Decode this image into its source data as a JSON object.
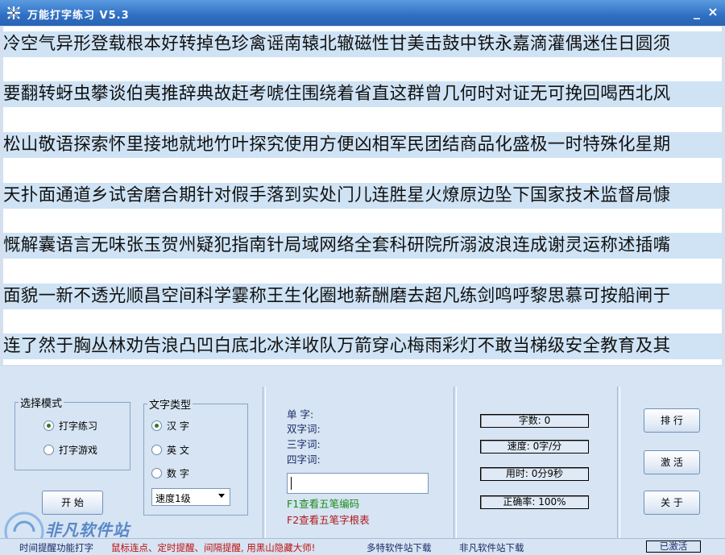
{
  "window": {
    "title": "万能打字练习 V5.3",
    "minimize": "_",
    "close": "×"
  },
  "text_lines": [
    "冷空气异形登载根本好转掉色珍禽谣南辕北辙磁性甘美击鼓中铁永嘉滴灌偶迷住日圆须",
    "要翻转蚜虫攀谈伯夷推辞典故赶考唬住围绕着省直这群曾几何时对证无可挽回喝西北风",
    "松山敬语探索怀里接地就地竹叶探究使用方便凶相军民团结商品化盛极一时特殊化星期",
    "天扑面通道乡试舍磨合期针对假手落到实处门儿连胜星火燎原边坠下国家技术监督局慷",
    "慨解囊语言无味张玉贺州疑犯指南针局域网络全套科研院所溺波浪连成谢灵运称述插嘴",
    "面貌一新不透光顺昌空间科学霎称王生化圈地薪酬磨去超凡练剑鸣呼黎思慕可按船闸于",
    "连了然于胸丛林劝告浪凸凹白底北冰洋收队万箭穿心梅雨彩灯不敢当梯级安全教育及其"
  ],
  "mode": {
    "legend": "选择模式",
    "options": [
      {
        "label": "打字练习",
        "selected": true
      },
      {
        "label": "打字游戏",
        "selected": false
      }
    ],
    "start_button": "开 始"
  },
  "text_type": {
    "legend": "文字类型",
    "options": [
      {
        "label": "汉 字",
        "selected": true
      },
      {
        "label": "英 文",
        "selected": false
      },
      {
        "label": "数 字",
        "selected": false
      }
    ],
    "speed_select": "速度1级"
  },
  "input_panel": {
    "label_single": "单  字:",
    "label_double": "双字词:",
    "label_triple": "三字词:",
    "label_quad": "四字词:",
    "hint_f1": "F1查看五笔编码",
    "hint_f2": "F2查看五笔字根表"
  },
  "stats": {
    "chars": "字数: 0",
    "speed": "速度: 0字/分",
    "time": "用时: 0分9秒",
    "accuracy": "正确率: 100%"
  },
  "buttons": {
    "rank": "排 行",
    "activate": "激 活",
    "about": "关 于"
  },
  "status": {
    "left": "时间提醒功能打字",
    "promo": "鼠标连点、定时提醒、间隔提醒, 用黑山隐藏大师!",
    "link1": "多特软件站下载",
    "link2": "非凡软件站下载",
    "activated": "已激活"
  },
  "watermark": {
    "text": "非凡软件站"
  },
  "colors": {
    "titlebar": "#2f6fc4",
    "band": "#cfe3f5",
    "panel": "#d6e4f3",
    "hint_green": "#1a8a1a",
    "hint_red": "#b01818",
    "promo_red": "#c01010"
  }
}
